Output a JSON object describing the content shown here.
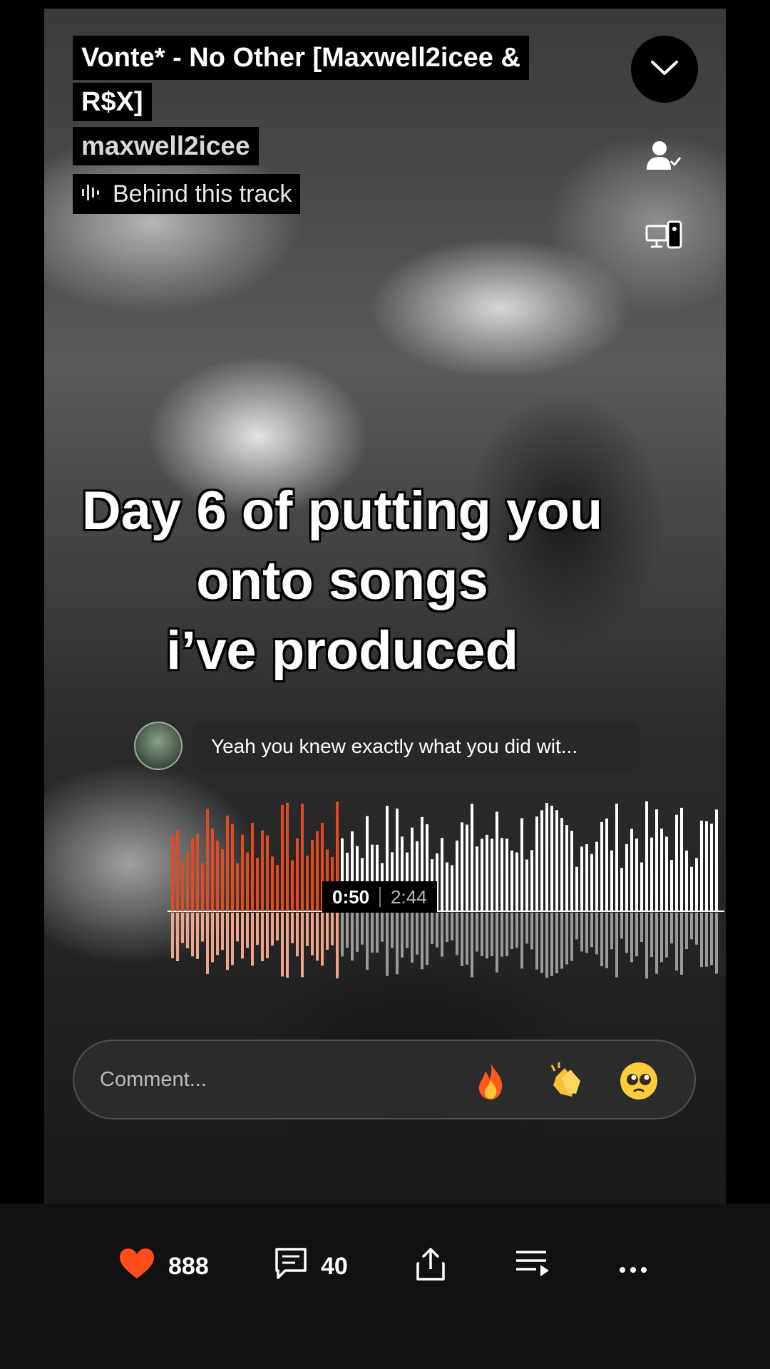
{
  "track": {
    "title_line1": "Vonte* - No Other [Maxwell2icee &",
    "title_line2": "R$X]",
    "artist": "maxwell2icee",
    "behind_label": "Behind this track"
  },
  "overlay_caption": {
    "line1": "Day 6 of putting you",
    "line2": "onto songs",
    "line3": "i’ve produced"
  },
  "comment_preview": {
    "text": "Yeah you knew exactly what you did wit..."
  },
  "player": {
    "current_time": "0:50",
    "total_time": "2:44",
    "progress": 0.305,
    "played_color": "#e34a1f",
    "played_reflection_color": "#f0a48a",
    "unplayed_color": "#ffffff",
    "unplayed_reflection_color": "#9a9a9a"
  },
  "comment_bar": {
    "placeholder": "Comment...",
    "emojis": [
      "fire-emoji",
      "clapping-hands-emoji",
      "pleading-face-emoji"
    ]
  },
  "actions": {
    "likes": "888",
    "comments": "40",
    "like_color": "#ff4d1a"
  },
  "icons": {
    "minimize": "chevron-down-icon",
    "follow": "user-check-icon",
    "cast": "cast-devices-icon",
    "share": "share-icon",
    "queue": "queue-icon",
    "more": "more-icon"
  }
}
